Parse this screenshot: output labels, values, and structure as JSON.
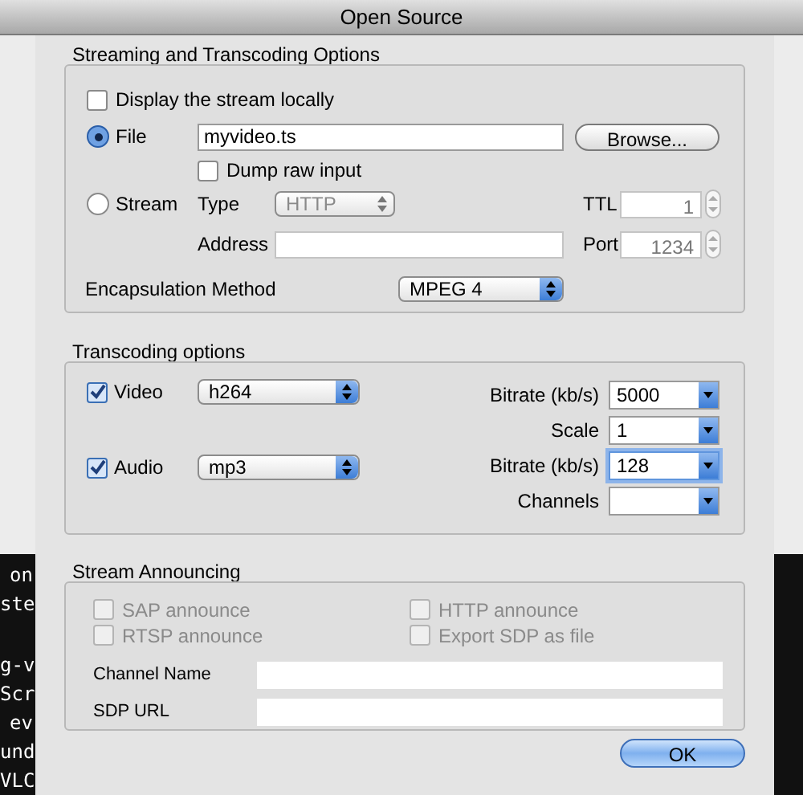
{
  "window": {
    "title": "Open Source"
  },
  "streaming": {
    "title": "Streaming and Transcoding Options",
    "display_locally": {
      "label": "Display the stream locally",
      "checked": false
    },
    "destinations": [
      {
        "label": "File",
        "selected": true
      },
      {
        "label": "Stream",
        "selected": false
      }
    ],
    "file": {
      "value": "myvideo.ts",
      "browse_button": "Browse..."
    },
    "dump_raw": {
      "label": "Dump raw input",
      "checked": false
    },
    "type": {
      "label": "Type",
      "value": "HTTP",
      "disabled": true
    },
    "ttl": {
      "label": "TTL",
      "value": "1",
      "disabled": true
    },
    "address": {
      "label": "Address"
    },
    "port": {
      "label": "Port",
      "value": "1234",
      "disabled": true
    },
    "encapsulation": {
      "label": "Encapsulation Method",
      "value": "MPEG 4"
    }
  },
  "transcoding": {
    "title": "Transcoding options",
    "tracks": [
      {
        "label": "Video",
        "checked": true,
        "codec": "h264"
      },
      {
        "label": "Audio",
        "checked": true,
        "codec": "mp3"
      }
    ],
    "fields": [
      {
        "label": "Bitrate (kb/s)",
        "value": "5000",
        "focused": false
      },
      {
        "label": "Scale",
        "value": "1",
        "focused": false
      },
      {
        "label": "Bitrate (kb/s)",
        "value": "128",
        "focused": true
      },
      {
        "label": "Channels",
        "focused": false
      }
    ]
  },
  "announcing": {
    "title": "Stream Announcing",
    "options": [
      {
        "label": "SAP announce",
        "checked": false,
        "disabled": true
      },
      {
        "label": "HTTP announce",
        "checked": false,
        "disabled": true
      },
      {
        "label": "RTSP announce",
        "checked": false,
        "disabled": true
      },
      {
        "label": "Export SDP as file",
        "checked": false,
        "disabled": true
      }
    ],
    "channel_name": {
      "label": "Channel Name"
    },
    "sdp_url": {
      "label": "SDP URL"
    }
  },
  "ok_button": "OK",
  "terminal": {
    "lines": [
      "on",
      "ste",
      "g-v",
      "Scr",
      "ev",
      "und",
      "VLC"
    ]
  }
}
